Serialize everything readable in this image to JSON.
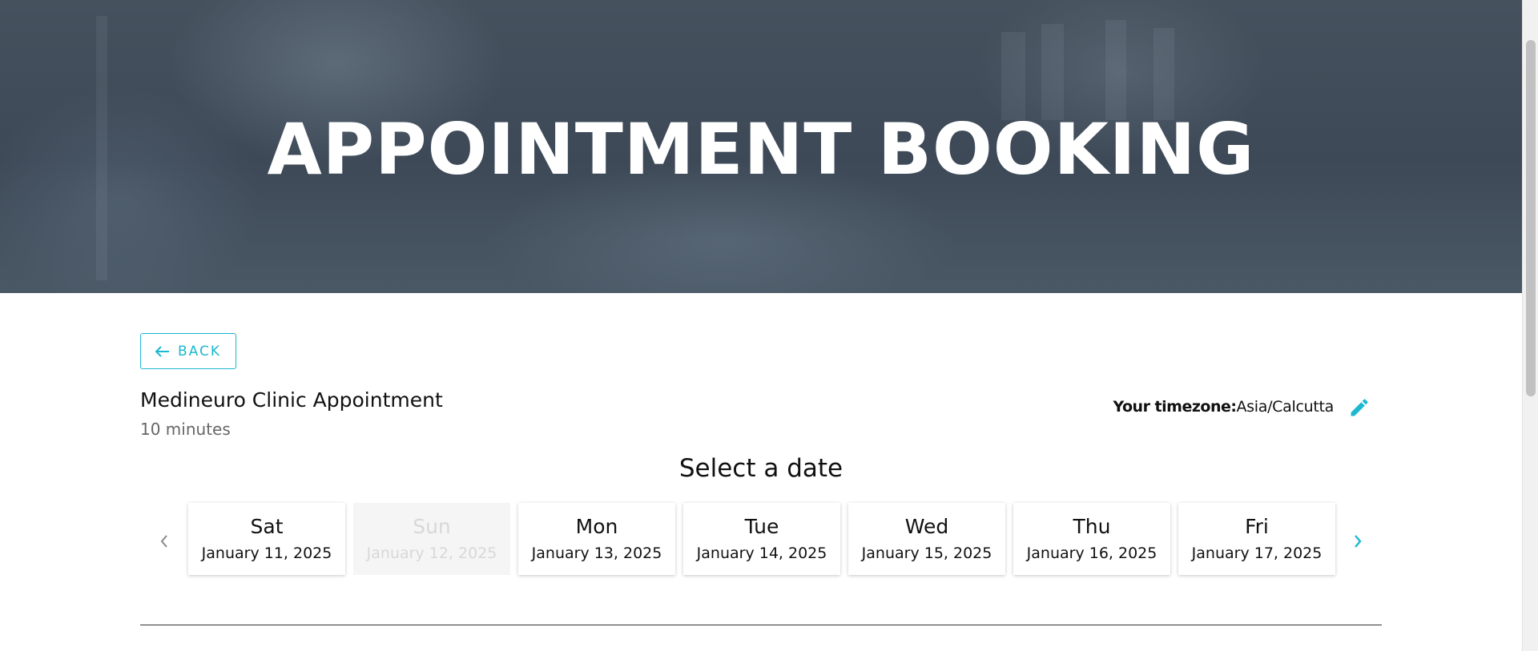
{
  "hero": {
    "title": "APPOINTMENT BOOKING"
  },
  "back_button": {
    "icon": "arrow-left-icon",
    "label": "BACK"
  },
  "appointment": {
    "title": "Medineuro Clinic Appointment",
    "duration": "10 minutes"
  },
  "timezone": {
    "label": "Your timezone:",
    "value": "Asia/Calcutta",
    "edit_icon": "pencil-icon"
  },
  "date_picker": {
    "heading": "Select a date",
    "prev_icon": "chevron-left-icon",
    "next_icon": "chevron-right-icon",
    "days": [
      {
        "day": "Sat",
        "date": "January 11, 2025",
        "disabled": false
      },
      {
        "day": "Sun",
        "date": "January 12, 2025",
        "disabled": true
      },
      {
        "day": "Mon",
        "date": "January 13, 2025",
        "disabled": false
      },
      {
        "day": "Tue",
        "date": "January 14, 2025",
        "disabled": false
      },
      {
        "day": "Wed",
        "date": "January 15, 2025",
        "disabled": false
      },
      {
        "day": "Thu",
        "date": "January 16, 2025",
        "disabled": false
      },
      {
        "day": "Fri",
        "date": "January 17, 2025",
        "disabled": false
      }
    ]
  },
  "colors": {
    "accent": "#1cb8d0",
    "hero_overlay": "#3d4957",
    "disabled_text": "#d8d8d8"
  }
}
